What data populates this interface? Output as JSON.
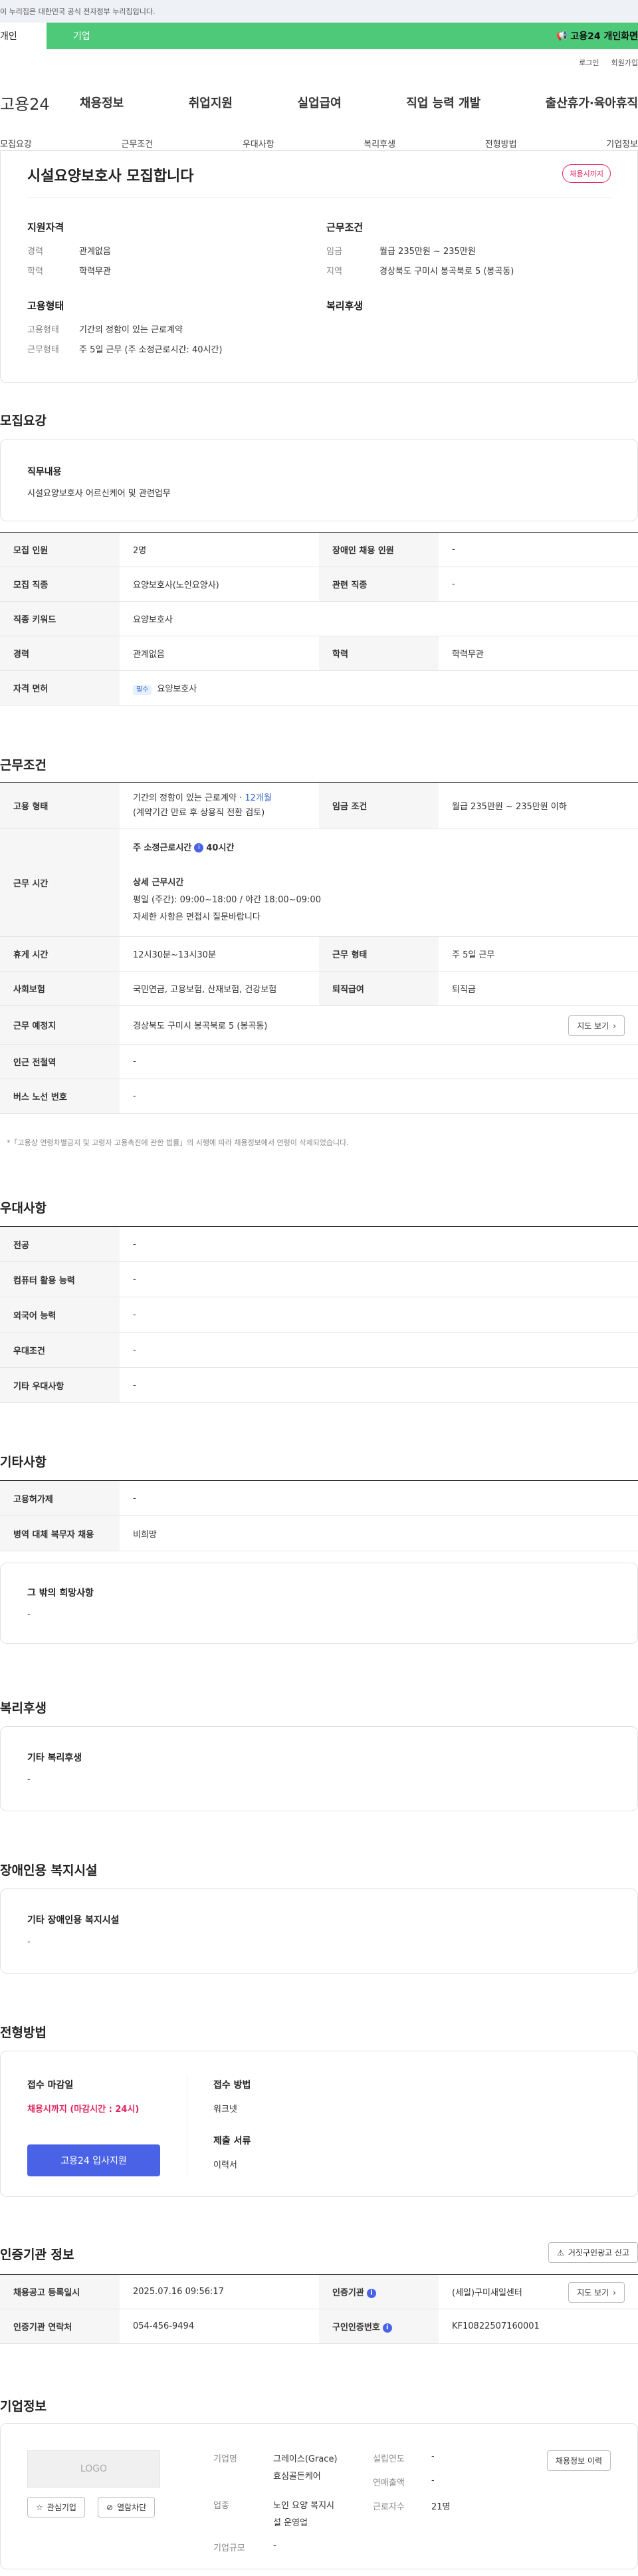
{
  "top": {
    "gov_notice": "이 누리집은 대한민국 공식 전자정부 누리집입니다.",
    "tab_personal": "개인",
    "tab_company": "기업",
    "right_label": "고용24 개인화면",
    "login": "로그인",
    "signup": "회원가입"
  },
  "gnb": {
    "logo": "고용24",
    "menu": [
      "채용정보",
      "취업지원",
      "실업급여",
      "직업 능력 개발",
      "출산휴가·육아휴직"
    ]
  },
  "subnav": [
    "모집요강",
    "근무조건",
    "우대사항",
    "복리후생",
    "전형방법",
    "기업정보"
  ],
  "summary": {
    "title": "시설요양보호사 모집합니다",
    "status_pill": "채용시까지",
    "qual_head": "지원자격",
    "career_lbl": "경력",
    "career_val": "관계없음",
    "edu_lbl": "학력",
    "edu_val": "학력무관",
    "cond_head": "근무조건",
    "wage_lbl": "임금",
    "wage_val": "월급 235만원 ~ 235만원",
    "region_lbl": "지역",
    "region_val": "경상북도 구미시 봉곡북로 5 (봉곡동)",
    "emp_head": "고용형태",
    "emp_type_lbl": "고용형태",
    "emp_type_val": "기간의 정함이 있는 근로계약",
    "work_form_lbl": "근무형태",
    "work_form_val": "주 5일 근무 (주 소정근로시간: 40시간)",
    "welfare_head": "복리후생"
  },
  "recruit": {
    "section": "모집요강",
    "duty_head": "직무내용",
    "duty_val": "시설요양보호사 어르신케어 및 관련업무",
    "rows": [
      {
        "l1": "모집 인원",
        "v1": "2명",
        "l2": "장애인 채용 인원",
        "v2": "-"
      },
      {
        "l1": "모집 직종",
        "v1": "요양보호사(노인요양사)",
        "l2": "관련 직종",
        "v2": "-"
      },
      {
        "l1": "직종 키워드",
        "v1": "요양보호사"
      },
      {
        "l1": "경력",
        "v1": "관계없음",
        "l2": "학력",
        "v2": "학력무관"
      },
      {
        "l1": "자격 면허",
        "badge": "필수",
        "v1": "요양보호사"
      }
    ]
  },
  "work": {
    "section": "근무조건",
    "emp_lbl": "고용 형태",
    "emp_val_a": "기간의 정함이 있는 근로계약 · ",
    "emp_val_months": "12개월",
    "emp_val_b": "(계약기간 만료 후 상용직 전환 검토)",
    "wage_lbl": "임금 조건",
    "wage_val": "월급 235만원 ~ 235만원 이하",
    "hours_lbl": "근무 시간",
    "hours_main": "주 소정근로시간",
    "hours_main_val": "40시간",
    "hours_detail_head": "상세 근무시간",
    "hours_detail_1": "평일 (주간): 09:00~18:00 / 야간 18:00~09:00",
    "hours_detail_2": "자세한 사항은 면접시 질문바랍니다",
    "break_lbl": "휴게 시간",
    "break_val": "12시30분~13시30분",
    "form_lbl": "근무 형태",
    "form_val": "주 5일 근무",
    "ins_lbl": "사회보험",
    "ins_val": "국민연금, 고용보험, 산재보험, 건강보험",
    "sev_lbl": "퇴직급여",
    "sev_val": "퇴직금",
    "place_lbl": "근무 예정지",
    "place_val": "경상북도 구미시 봉곡북로 5 (봉곡동)",
    "map_btn": "지도 보기",
    "subway_lbl": "인근 전철역",
    "subway_val": "-",
    "bus_lbl": "버스 노선 번호",
    "bus_val": "-",
    "note": "*「고용상 연령차별금지 및 고령자 고용촉진에 관한 법률」의 시행에 따라 채용정보에서 연령이 삭제되었습니다."
  },
  "pref": {
    "section": "우대사항",
    "rows": [
      {
        "l": "전공",
        "v": "-"
      },
      {
        "l": "컴퓨터 활용 능력",
        "v": "-"
      },
      {
        "l": "외국어 능력",
        "v": "-"
      },
      {
        "l": "우대조건",
        "v": "-"
      },
      {
        "l": "기타 우대사항",
        "v": "-"
      }
    ]
  },
  "etc": {
    "section": "기타사항",
    "rows": [
      {
        "l": "고용허가제",
        "v": "-"
      },
      {
        "l": "병역 대체 복무자 채용",
        "v": "비희망"
      }
    ],
    "other_head": "그 밖의 희망사항",
    "other_val": "-"
  },
  "welfare": {
    "section": "복리후생",
    "head": "기타 복리후생",
    "val": "-"
  },
  "disabled": {
    "section": "장애인용 복지시설",
    "head": "기타 장애인용 복지시설",
    "val": "-"
  },
  "selection": {
    "section": "전형방법",
    "deadline_head": "접수 마감일",
    "deadline_val": "채용시까지 (마감시간 : 24시)",
    "apply_btn": "고용24 입사지원",
    "method_head": "접수 방법",
    "method_val": "워크넷",
    "docs_head": "제출 서류",
    "docs_val": "이력서"
  },
  "cert": {
    "section": "인증기관 정보",
    "report_btn": "거짓구인광고 신고",
    "reg_lbl": "채용공고 등록일시",
    "reg_val": "2025.07.16 09:56:17",
    "agency_lbl": "인증기관",
    "agency_val": "(세일)구미새일센터",
    "map_btn": "지도 보기",
    "contact_lbl": "인증기관 연락처",
    "contact_val": "054-456-9494",
    "reqno_lbl": "구인인증번호",
    "reqno_val": "KF10822507160001"
  },
  "company": {
    "section": "기업정보",
    "logo_text": "LOGO",
    "fav_btn": "관심기업",
    "block_btn": "열람차단",
    "name_lbl": "기업명",
    "name_val_1": "그레이스(Grace)",
    "name_val_2": "효심골든케어",
    "industry_lbl": "업종",
    "industry_val_1": "노인 요양 복지시",
    "industry_val_2": "설 운영업",
    "size_lbl": "기업규모",
    "size_val": "-",
    "founded_lbl": "설립연도",
    "founded_val": "-",
    "sales_lbl": "연매출액",
    "sales_val": "-",
    "staff_lbl": "근로자수",
    "staff_val": "21명",
    "history_btn": "채용정보 이력"
  }
}
